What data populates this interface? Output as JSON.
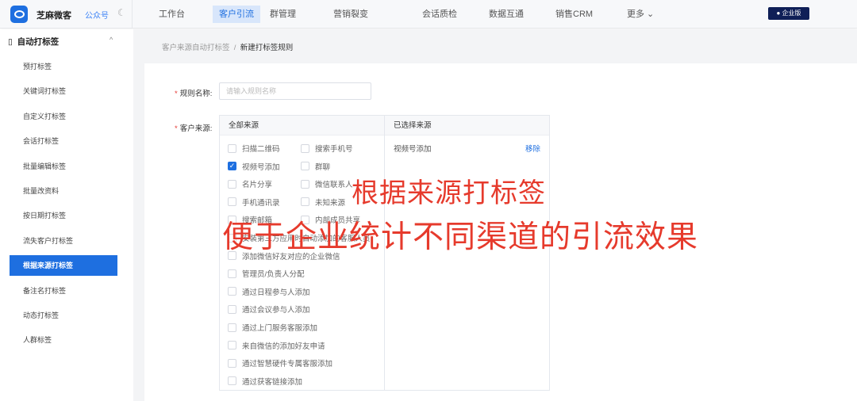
{
  "header": {
    "brand": "芝麻微客",
    "gzh": "公众号",
    "nav": [
      "工作台",
      "客户引流",
      "群管理",
      "营销裂变",
      "会话质检",
      "数据互通",
      "销售CRM",
      "更多 ⌄"
    ],
    "active_nav": 1,
    "edition": "企业版"
  },
  "sidebar": {
    "group": "自动打标签",
    "items": [
      "预打标签",
      "关键词打标签",
      "自定义打标签",
      "会话打标签",
      "批量编辑标签",
      "批量改资料",
      "按日期打标签",
      "流失客户打标签",
      "根据来源打标签",
      "备注名打标签",
      "动态打标签",
      "人群标签"
    ],
    "active": 8
  },
  "breadcrumb": {
    "parent": "客户来源自动打标签",
    "sep": "/",
    "current": "新建打标签规则"
  },
  "form": {
    "name_label": "规则名称:",
    "name_placeholder": "请输入规则名称",
    "name_value": "",
    "source_label": "客户来源:"
  },
  "transfer": {
    "left_title": "全部来源",
    "right_title": "已选择来源",
    "pairs": [
      [
        "扫描二维码",
        "搜索手机号"
      ],
      [
        "视频号添加",
        "群聊"
      ],
      [
        "名片分享",
        "微信联系人"
      ],
      [
        "手机通讯录",
        "未知来源"
      ],
      [
        "搜索邮箱",
        "内部成员共享"
      ]
    ],
    "singles": [
      "安装第三方应用时自动添加的客服人员",
      "添加微信好友对应的企业微信",
      "管理员/负责人分配",
      "通过日程参与人添加",
      "通过会议参与人添加",
      "通过上门服务客服添加",
      "来自微信的添加好友申请",
      "通过智慧硬件专属客服添加",
      "通过获客链接添加"
    ],
    "checked": [
      "视频号添加"
    ],
    "selected": [
      {
        "label": "视频号添加",
        "action": "移除"
      }
    ]
  },
  "overlay": {
    "line1": "根据来源打标签",
    "line2": "便于企业统计不同渠道的引流效果"
  }
}
